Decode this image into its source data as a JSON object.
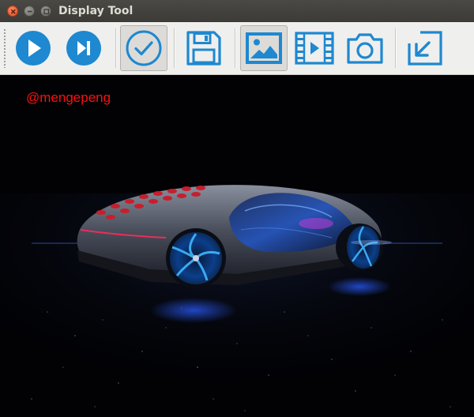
{
  "window": {
    "title": "Display Tool"
  },
  "titlebar_buttons": [
    {
      "name": "close",
      "color": "#e9572a"
    },
    {
      "name": "minimize",
      "color": "#7d7b76"
    },
    {
      "name": "maximize",
      "color": "#7d7b76"
    }
  ],
  "toolbar": {
    "accent_color": "#1e88d0",
    "buttons": [
      {
        "icon": "play-icon",
        "checked": false
      },
      {
        "icon": "step-forward-icon",
        "checked": false
      },
      {
        "icon": "check-circle-icon",
        "checked": true
      },
      {
        "icon": "save-icon",
        "checked": false
      },
      {
        "icon": "image-icon",
        "checked": true
      },
      {
        "icon": "video-icon",
        "checked": false
      },
      {
        "icon": "camera-icon",
        "checked": false
      },
      {
        "icon": "resize-arrow-icon",
        "checked": false
      }
    ]
  },
  "display": {
    "watermark": "@mengepeng",
    "watermark_color": "#ff0e0e",
    "background": "#020205",
    "image_subject": "futuristic concept car"
  }
}
